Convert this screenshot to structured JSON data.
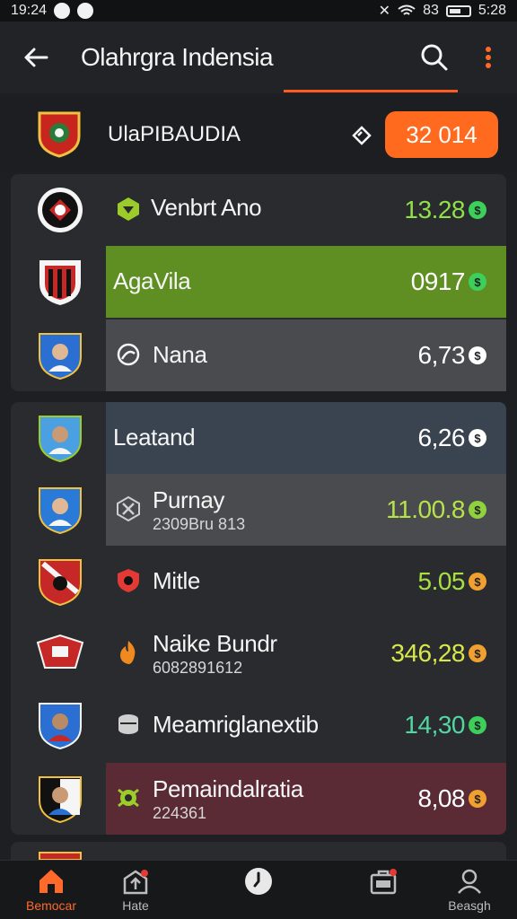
{
  "status_bar": {
    "time_left": "19:24",
    "time_right": "5:28",
    "signal_text": "83"
  },
  "app_bar": {
    "title": "Olahrgra Indensia"
  },
  "league": {
    "name": "UlaPIBAUDIA",
    "score": "32 014"
  },
  "rows": [
    {
      "name": "Venbrt Ano",
      "value": "13.28",
      "value_color": "#8fe04a",
      "coin_color": "#3ccf5a"
    },
    {
      "name": "AgaVila",
      "value": "0917",
      "value_color": "#ffffff",
      "coin_color": "#3ccf5a"
    },
    {
      "name": "Nana",
      "value": "6,73",
      "value_color": "#ffffff",
      "coin_color": "#ffffff"
    },
    {
      "name": "Leatand",
      "value": "6,26",
      "value_color": "#ffffff",
      "coin_color": "#ffffff"
    },
    {
      "name": "Purnay",
      "subtext": "2309Bru 813",
      "value": "11.00.8",
      "value_color": "#b7e24a",
      "coin_color": "#8fd23e"
    },
    {
      "name": "Mitle",
      "value": "5.05",
      "value_color": "#a8e040",
      "coin_color": "#f0a030"
    },
    {
      "name": "Naike Bundr",
      "subtext": "6082891612",
      "value": "346,28",
      "value_color": "#d8e84a",
      "coin_color": "#f0a030"
    },
    {
      "name": "Meamriglanextib",
      "value": "14,30",
      "value_color": "#52d6a2",
      "coin_color": "#3ccf5a"
    },
    {
      "name": "Pemaindalratia",
      "subtext": "224361",
      "value": "8,08",
      "value_color": "#ffffff",
      "coin_color": "#f0a030"
    }
  ],
  "bottom_nav": [
    {
      "label": "Bemocar",
      "icon": "home-icon"
    },
    {
      "label": "Hate",
      "icon": "upload-icon"
    },
    {
      "label": "",
      "icon": "clock-icon"
    },
    {
      "label": "",
      "icon": "briefcase-icon"
    },
    {
      "label": "Beasgh",
      "icon": "profile-icon"
    }
  ],
  "colors": {
    "accent": "#ff6a1f",
    "background": "#1e1f22",
    "highlight_green": "#5f8f23",
    "highlight_red": "#5a2a35"
  }
}
